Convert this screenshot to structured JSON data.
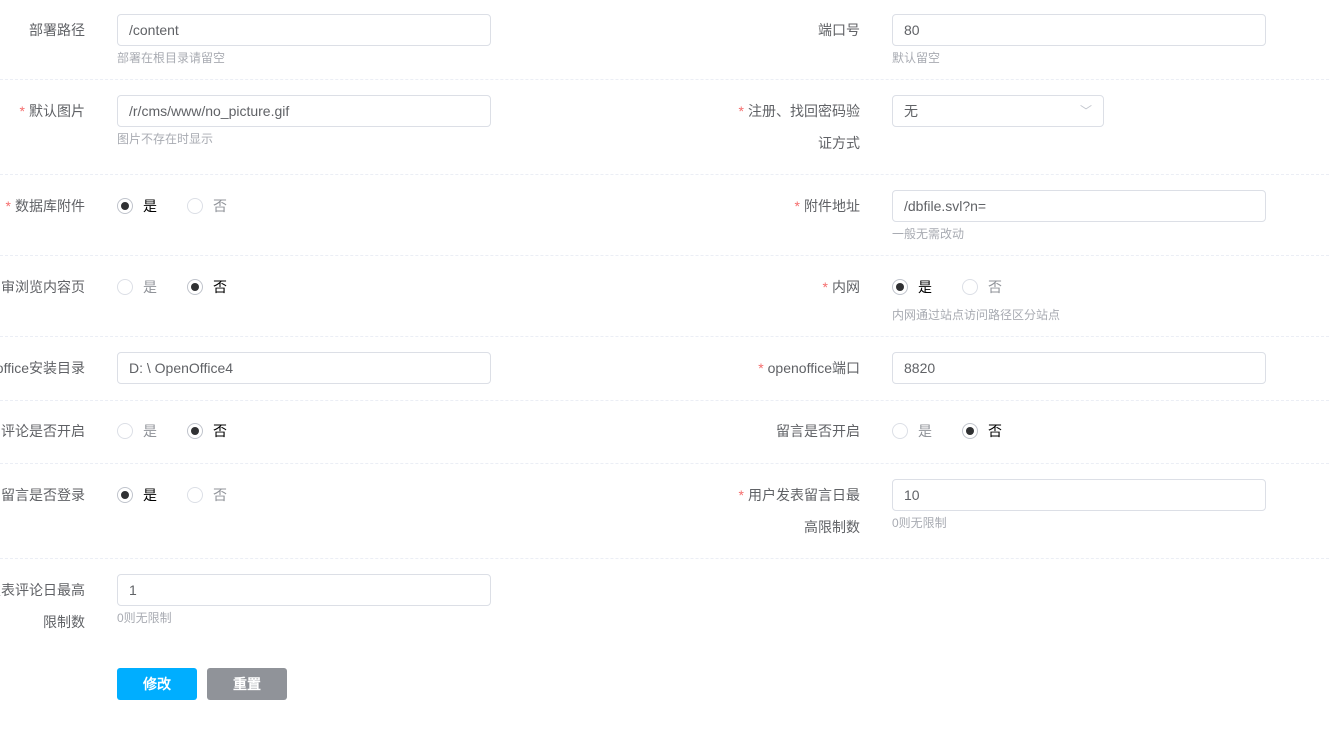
{
  "form": {
    "deploy_path": {
      "label": "部署路径",
      "value": "/content",
      "hint": "部署在根目录请留空"
    },
    "port": {
      "label": "端口号",
      "value": "80",
      "hint": "默认留空"
    },
    "default_image": {
      "label": "默认图片",
      "value": "/r/cms/www/no_picture.gif",
      "hint": "图片不存在时显示"
    },
    "verify_method": {
      "label": "注册、找回密码验证方式",
      "value": "无"
    },
    "db_attachment": {
      "label": "数据库附件",
      "yes": "是",
      "no": "否",
      "selected": "是"
    },
    "attachment_url": {
      "label": "附件地址",
      "value": "/dbfile.svl?n=",
      "hint": "一般无需改动"
    },
    "review_browse": {
      "label": "审浏览内容页",
      "yes": "是",
      "no": "否",
      "selected": "否"
    },
    "intranet": {
      "label": "内网",
      "yes": "是",
      "no": "否",
      "selected": "是",
      "hint": "内网通过站点访问路径区分站点"
    },
    "openoffice_dir": {
      "label": "office安装目录",
      "value": "D: \\ OpenOffice4"
    },
    "openoffice_port": {
      "label": "openoffice端口",
      "value": "8820"
    },
    "comment_open": {
      "label": "评论是否开启",
      "yes": "是",
      "no": "否",
      "selected": "否"
    },
    "guestbook_open": {
      "label": "留言是否开启",
      "yes": "是",
      "no": "否",
      "selected": "否"
    },
    "guestbook_login": {
      "label": "留言是否登录",
      "yes": "是",
      "no": "否",
      "selected": "是"
    },
    "guestbook_daily_limit": {
      "label": "用户发表留言日最高限制数",
      "value": "10",
      "hint": "0则无限制"
    },
    "comment_daily_limit": {
      "label": "发表评论日最高 限制数",
      "value": "1",
      "hint": "0则无限制"
    }
  },
  "buttons": {
    "submit": "修改",
    "reset": "重置"
  },
  "colors": {
    "primary": "#00aeff",
    "reset": "#909399",
    "required": "#f56c6c"
  }
}
